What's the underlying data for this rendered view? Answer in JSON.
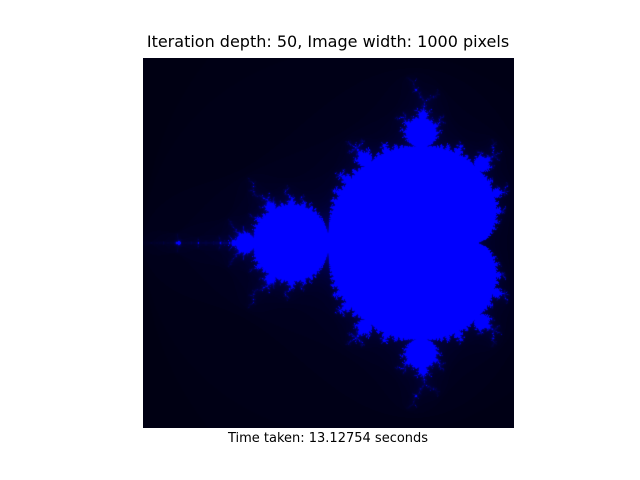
{
  "figure": {
    "title": "Iteration depth: 50, Image width: 1000 pixels",
    "caption": "Time taken: 13.12754 seconds"
  },
  "fractal": {
    "name": "Mandelbrot set",
    "max_iterations": 50,
    "re_range": [
      -2.0,
      0.5
    ],
    "im_range": [
      -1.25,
      1.25
    ],
    "set_color": "#0000ff",
    "background_color": "#000000"
  }
}
